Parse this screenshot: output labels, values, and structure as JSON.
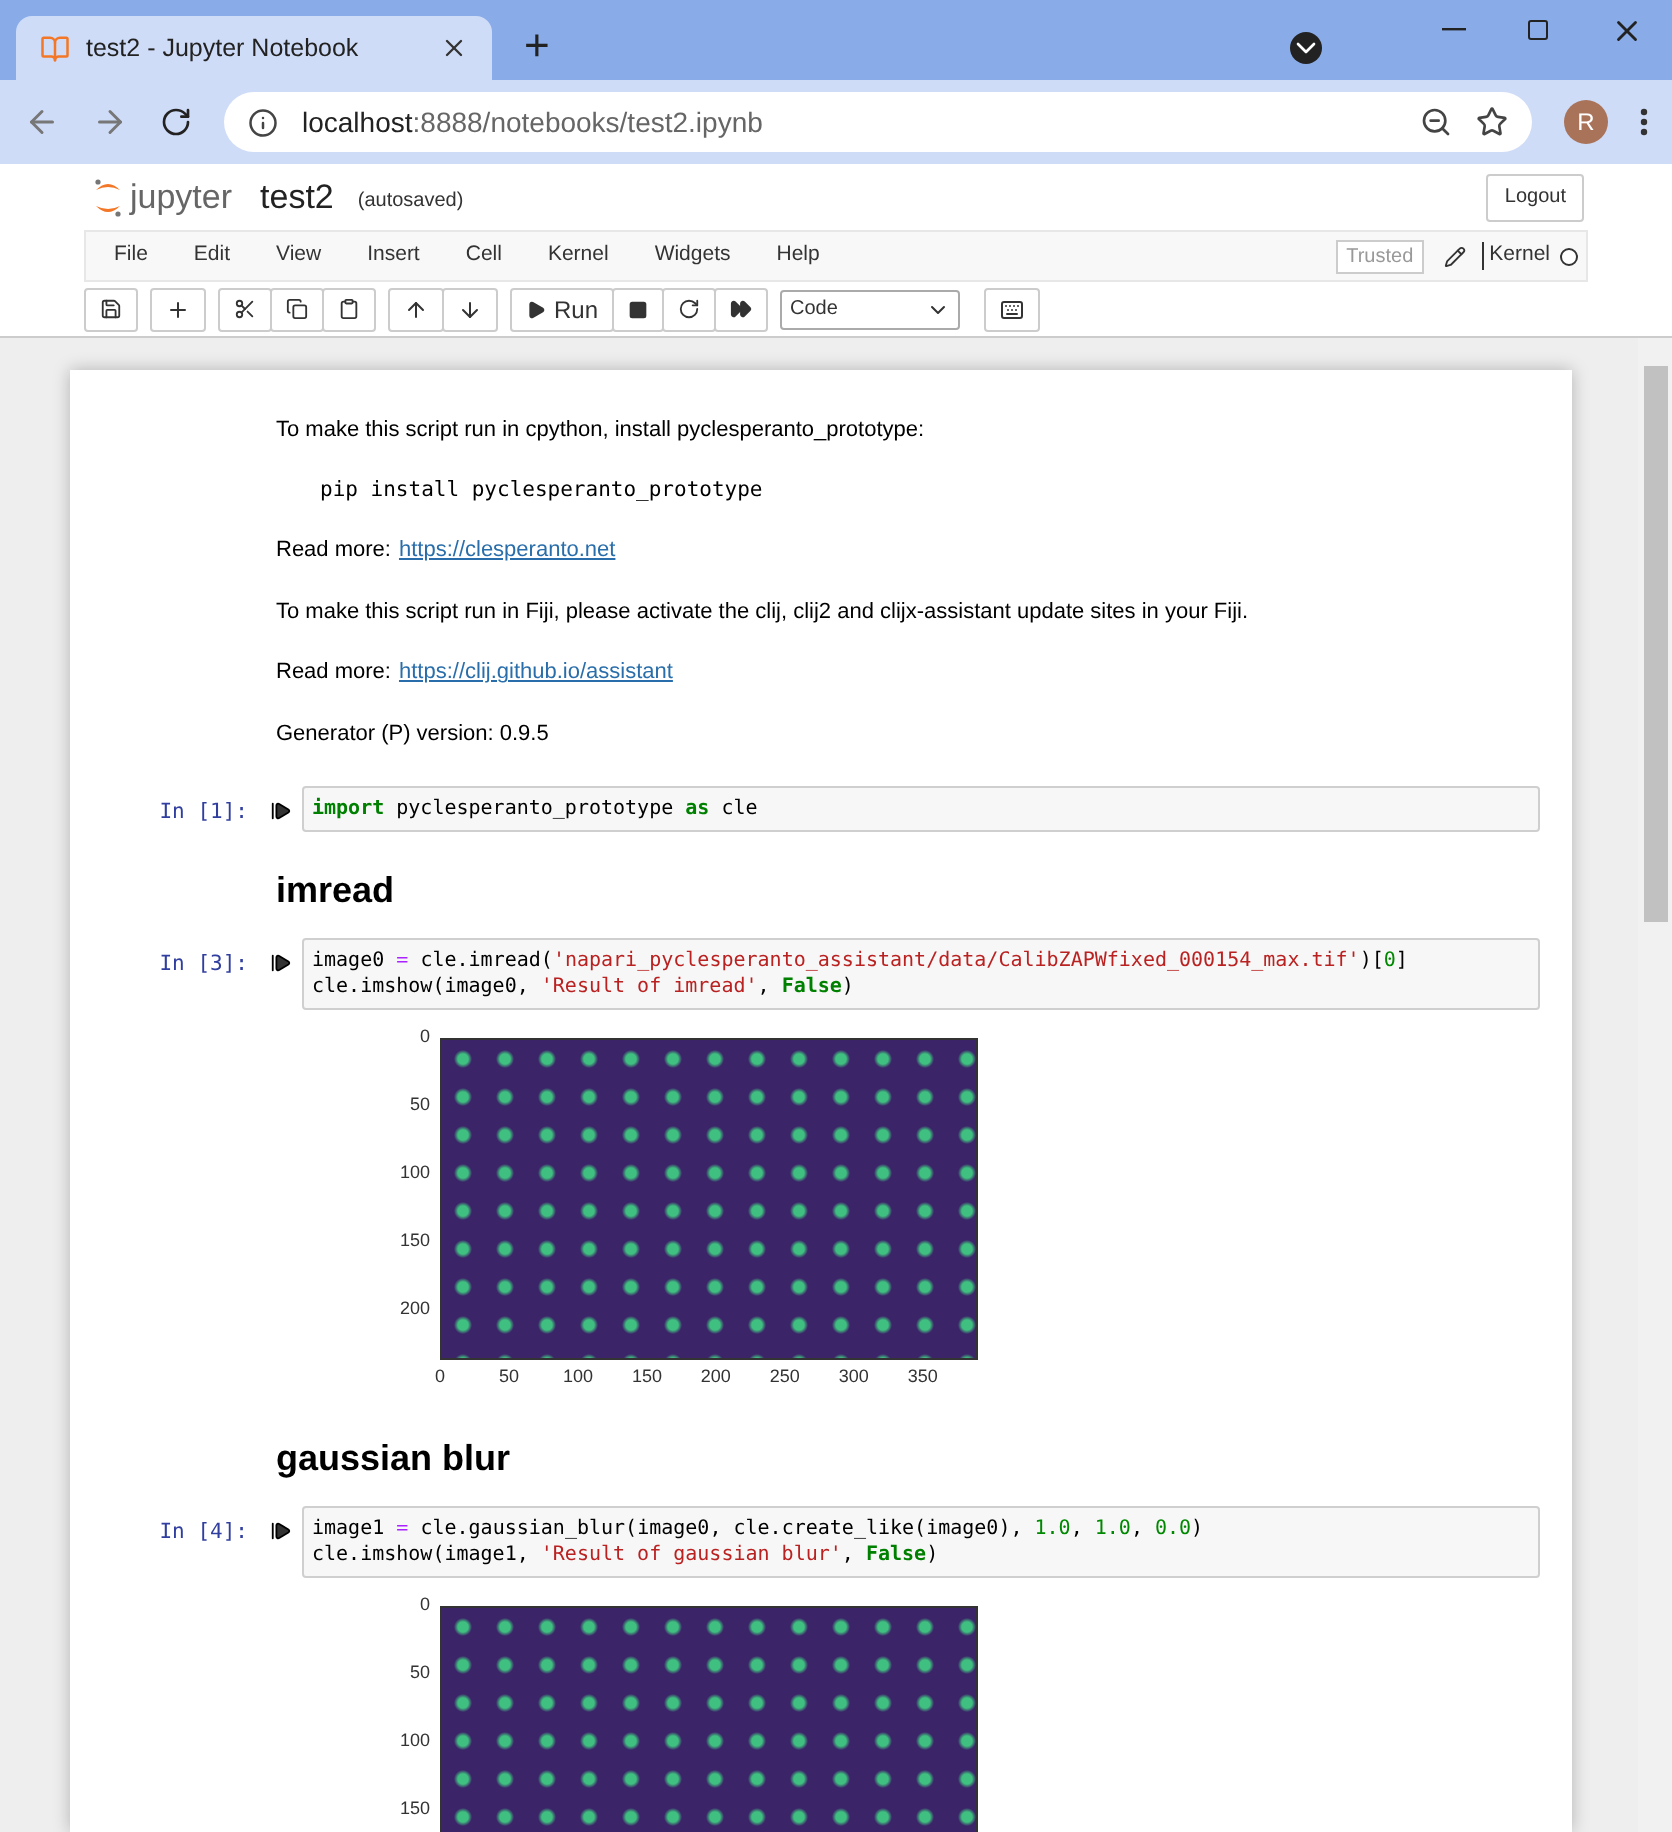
{
  "browser": {
    "tab_title": "test2 - Jupyter Notebook",
    "new_tab": "+",
    "url_host": "localhost",
    "url_rest": ":8888/notebooks/test2.ipynb",
    "profile": "R"
  },
  "header": {
    "logo_text": "jupyter",
    "notebook_name": "test2",
    "save_status": "(autosaved)",
    "logout": "Logout"
  },
  "menu": [
    "File",
    "Edit",
    "View",
    "Insert",
    "Cell",
    "Kernel",
    "Widgets",
    "Help"
  ],
  "trusted": "Trusted",
  "kernel_label": "Kernel",
  "kernel_busy": false,
  "toolbar": {
    "run_label": "Run",
    "cell_type": "Code"
  },
  "cells": [
    {
      "kind": "markdown",
      "blocks": [
        {
          "kind": "text",
          "text": "To make this script run in cpython, install pyclesperanto_prototype:"
        },
        {
          "kind": "pre",
          "text": "pip install pyclesperanto_prototype"
        },
        {
          "kind": "link",
          "text": "Read more:",
          "link": "https://clesperanto.net"
        },
        {
          "kind": "text",
          "text": "To make this script run in Fiji, please activate the clij, clij2 and clijx-assistant update sites in your Fiji."
        },
        {
          "kind": "link",
          "text": "Read more:",
          "link": "https://clij.github.io/assistant"
        },
        {
          "kind": "text",
          "text": "Generator (P) version: 0.9.5"
        }
      ]
    },
    {
      "kind": "code",
      "prompt": "In [1]:",
      "lines": [
        [
          {
            "t": "import",
            "kind": "keyword"
          },
          {
            "t": " pyclesperanto_prototype ",
            "kind": "plain"
          },
          {
            "t": "as",
            "kind": "keyword"
          },
          {
            "t": " cle",
            "kind": "plain"
          }
        ]
      ]
    },
    {
      "kind": "heading",
      "text": "imread"
    },
    {
      "kind": "code",
      "prompt": "In [3]:",
      "lines": [
        [
          {
            "t": "image0 ",
            "kind": "plain"
          },
          {
            "t": "=",
            "kind": "operator"
          },
          {
            "t": " cle.imread(",
            "kind": "plain"
          },
          {
            "t": "'napari_pyclesperanto_assistant/data/CalibZAPWfixed_000154_max.tif'",
            "kind": "string"
          },
          {
            "t": ")[",
            "kind": "plain"
          },
          {
            "t": "0",
            "kind": "number"
          },
          {
            "t": "]",
            "kind": "plain"
          }
        ],
        [
          {
            "t": "cle.imshow(image0, ",
            "kind": "plain"
          },
          {
            "t": "'Result of imread'",
            "kind": "string"
          },
          {
            "t": ", ",
            "kind": "plain"
          },
          {
            "t": "False",
            "kind": "keyword"
          },
          {
            "t": ")",
            "kind": "plain"
          }
        ]
      ],
      "output": {
        "yticks": [
          "0",
          "50",
          "100",
          "150",
          "200"
        ],
        "xticks": [
          "0",
          "50",
          "100",
          "150",
          "200",
          "250",
          "300",
          "350"
        ]
      }
    },
    {
      "kind": "heading",
      "text": "gaussian blur"
    },
    {
      "kind": "code",
      "prompt": "In [4]:",
      "lines": [
        [
          {
            "t": "image1 ",
            "kind": "plain"
          },
          {
            "t": "=",
            "kind": "operator"
          },
          {
            "t": " cle.gaussian_blur(image0, cle.create_like(image0), ",
            "kind": "plain"
          },
          {
            "t": "1.0",
            "kind": "number"
          },
          {
            "t": ", ",
            "kind": "plain"
          },
          {
            "t": "1.0",
            "kind": "number"
          },
          {
            "t": ", ",
            "kind": "plain"
          },
          {
            "t": "0.0",
            "kind": "number"
          },
          {
            "t": ")",
            "kind": "plain"
          }
        ],
        [
          {
            "t": "cle.imshow(image1, ",
            "kind": "plain"
          },
          {
            "t": "'Result of gaussian blur'",
            "kind": "string"
          },
          {
            "t": ", ",
            "kind": "plain"
          },
          {
            "t": "False",
            "kind": "keyword"
          },
          {
            "t": ")",
            "kind": "plain"
          }
        ]
      ],
      "output": {
        "yticks": [
          "0",
          "50",
          "100",
          "150"
        ]
      }
    }
  ]
}
